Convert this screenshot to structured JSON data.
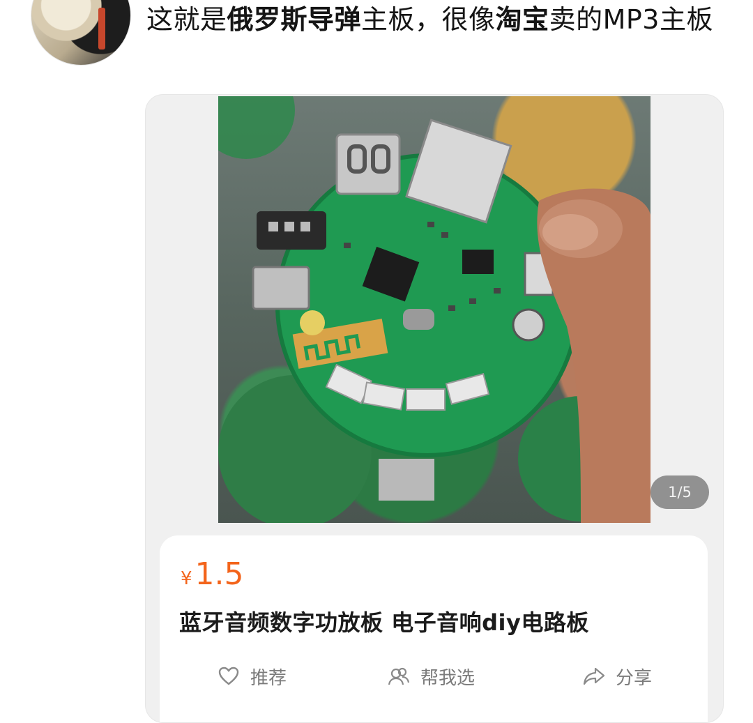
{
  "post": {
    "segments": [
      {
        "text": "这就是",
        "bold": false
      },
      {
        "text": "俄罗斯导弹",
        "bold": true
      },
      {
        "text": "主板，很像",
        "bold": false
      },
      {
        "text": "淘宝",
        "bold": true
      },
      {
        "text": "卖的MP3主板",
        "bold": false
      }
    ]
  },
  "media": {
    "pager": "1/5"
  },
  "product": {
    "currency": "¥",
    "price": "1.5",
    "title": "蓝牙音频数字功放板 电子音响diy电路板",
    "actions": {
      "recommend": "推荐",
      "help_choose": "帮我选",
      "share": "分享"
    }
  },
  "icons": {
    "recommend": "heart-icon",
    "help_choose": "people-icon",
    "share": "share-arrow-icon"
  },
  "colors": {
    "price": "#f3641b",
    "action_text": "#7b7b7b",
    "pcb_green": "#1f9a52"
  }
}
